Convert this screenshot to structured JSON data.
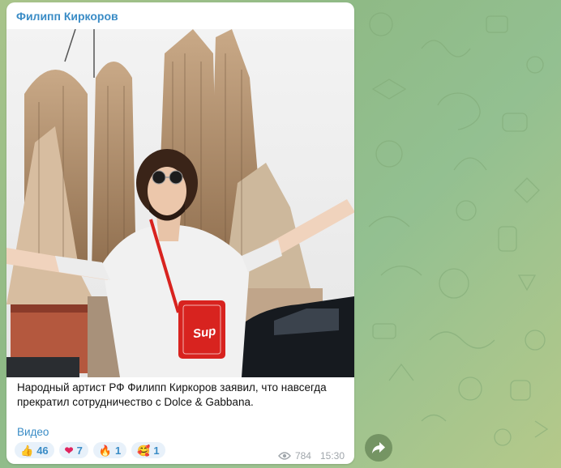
{
  "post": {
    "sender": "Филипп Киркоров",
    "caption": "Народный артист РФ Филипп Киркоров заявил, что навсегда прекратил сотрудничество с Dolce & Gabbana.",
    "link_label": "Видео",
    "reactions": [
      {
        "emoji": "👍",
        "count": "46"
      },
      {
        "emoji": "❤",
        "count": "7"
      },
      {
        "emoji": "🔥",
        "count": "1"
      },
      {
        "emoji": "🥰",
        "count": "1"
      }
    ],
    "views": "784",
    "time": "15:30",
    "bag_text": "Sup"
  },
  "colors": {
    "accent": "#3a8cc6",
    "bubble": "#ffffff",
    "reaction_bg": "#e8f1fa",
    "bag": "#d8231f"
  }
}
